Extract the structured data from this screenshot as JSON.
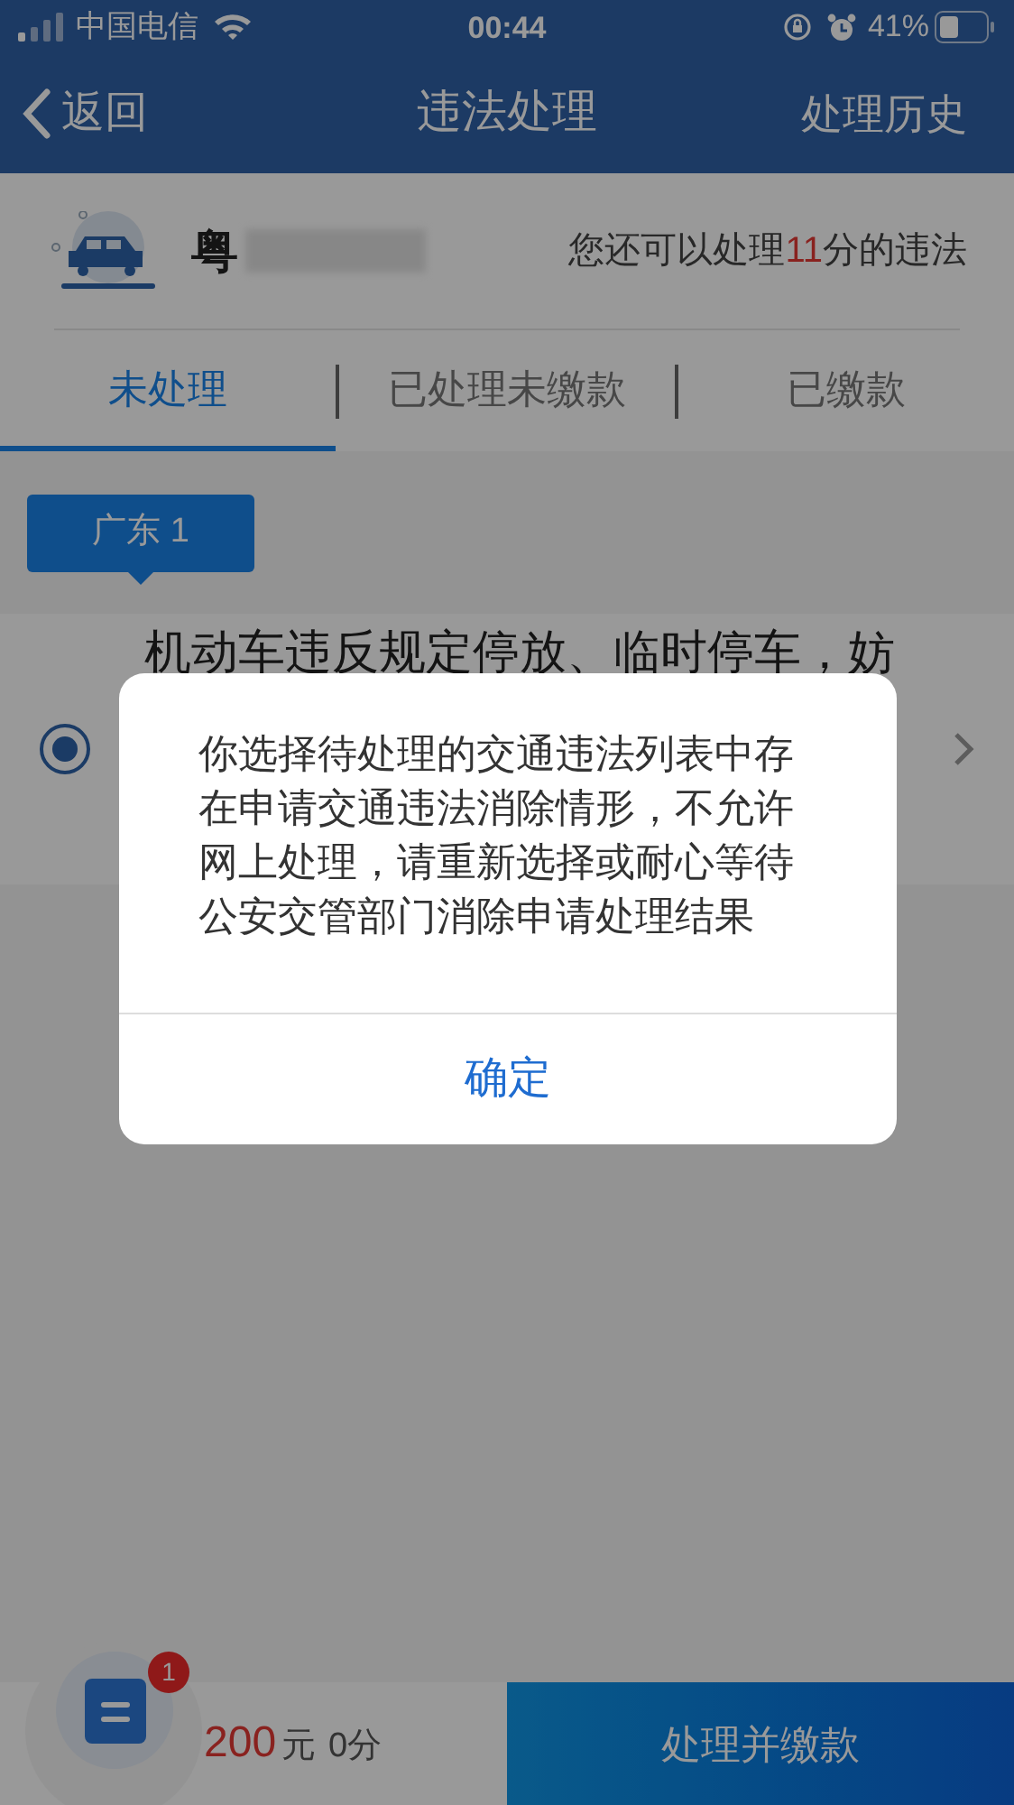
{
  "status_bar": {
    "carrier": "中国电信",
    "time": "00:44",
    "battery": "41%"
  },
  "nav": {
    "back": "返回",
    "title": "违法处理",
    "action": "处理历史"
  },
  "vehicle": {
    "province": "粤",
    "hint_prefix": "您还可以处理",
    "points": "11",
    "hint_suffix": "分的违法"
  },
  "tabs": [
    {
      "label": "未处理",
      "selected": true
    },
    {
      "label": "已处理未缴款",
      "selected": false
    },
    {
      "label": "已缴款",
      "selected": false
    }
  ],
  "region_tag": "广东 1",
  "violations": [
    {
      "text": "机动车违反规定停放、临时停车，妨",
      "selected": true
    }
  ],
  "footer": {
    "badge": "1",
    "amount": "200",
    "currency": "元",
    "points": "0分",
    "button": "处理并缴款"
  },
  "dialog": {
    "message": "你选择待处理的交通违法列表中存在申请交通违法消除情形，不允许网上处理，请重新选择或耐心等待公安交管部门消除申请处理结果",
    "button": "确定"
  }
}
